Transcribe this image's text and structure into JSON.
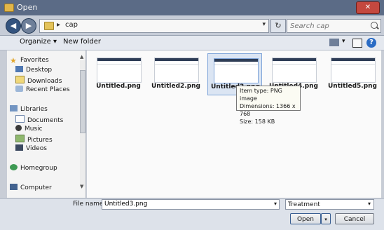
{
  "window": {
    "title": "Open",
    "close_glyph": "✕"
  },
  "nav": {
    "back_glyph": "◀",
    "forward_glyph": "▶",
    "refresh_glyph": "↻"
  },
  "address": {
    "arrow": "▸",
    "path": "cap",
    "dropdown_glyph": "▾"
  },
  "search": {
    "placeholder": "Search cap"
  },
  "toolbar": {
    "organize_label": "Organize ▾",
    "new_folder_label": "New folder",
    "views_dropdown_glyph": "▾",
    "help_glyph": "?"
  },
  "sidebar": {
    "favorites_label": "Favorites",
    "desktop_label": "Desktop",
    "downloads_label": "Downloads",
    "recent_label": "Recent Places",
    "libraries_label": "Libraries",
    "documents_label": "Documents",
    "music_label": "Music",
    "pictures_label": "Pictures",
    "videos_label": "Videos",
    "homegroup_label": "Homegroup",
    "computer_label": "Computer",
    "scroll_up": "▲",
    "scroll_down": "▼"
  },
  "files": [
    {
      "name": "Untitled.png"
    },
    {
      "name": "Untitled2.png"
    },
    {
      "name": "Untitled3.png"
    },
    {
      "name": "Untitled4.png"
    },
    {
      "name": "Untitled5.png"
    }
  ],
  "tooltip": {
    "line1": "Item type: PNG image",
    "line2": "Dimensions: 1366 x 768",
    "line3": "Size: 158 KB"
  },
  "footer": {
    "file_name_label": "File name:",
    "file_name_value": "Untitled3.png",
    "file_type_value": "Treatment",
    "dropdown_glyph": "▾",
    "open_label": "Open",
    "open_split_glyph": "▾",
    "cancel_label": "Cancel"
  }
}
